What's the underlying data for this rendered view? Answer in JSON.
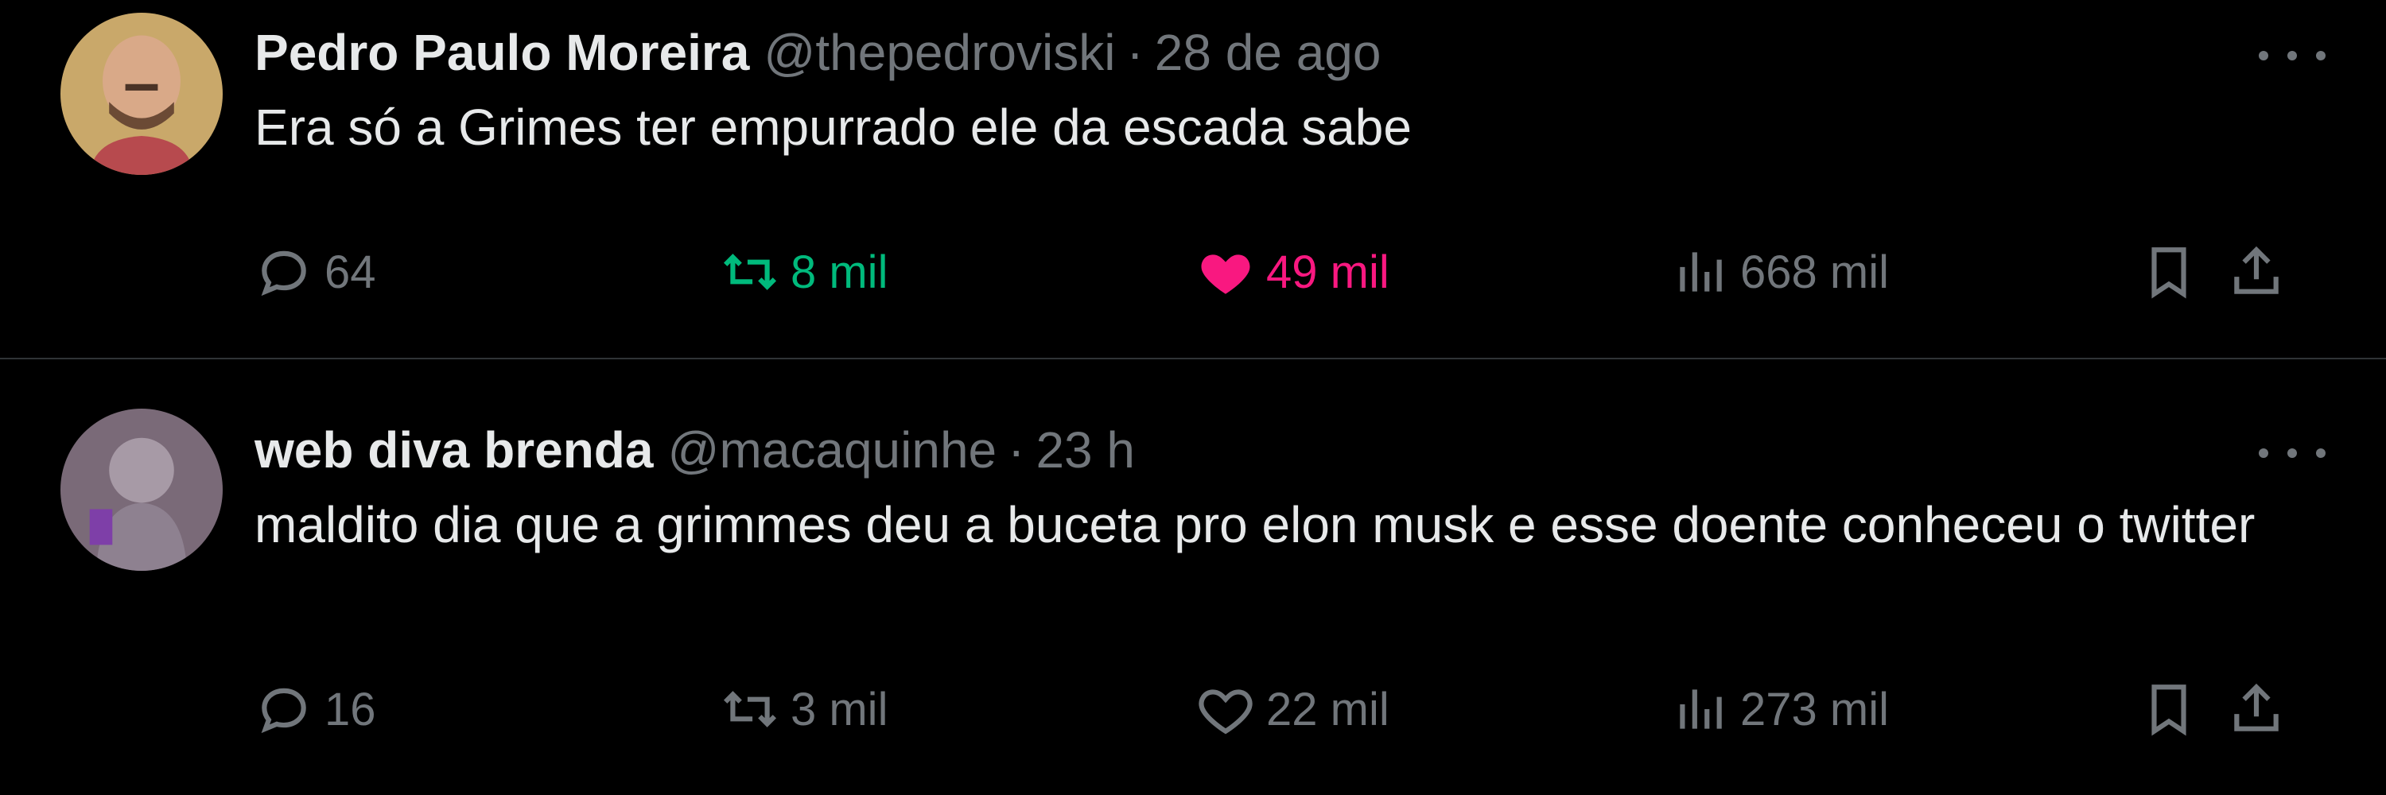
{
  "tweets": [
    {
      "author_name": "Pedro Paulo Moreira",
      "handle": "@thepedroviski",
      "separator": "·",
      "time": "28 de ago",
      "text": "Era só a Grimes ter empurrado ele da escada sabe",
      "replies": "64",
      "retweets": "8 mil",
      "likes": "49 mil",
      "views": "668 mil",
      "retweeted": true,
      "liked": true
    },
    {
      "author_name": "web diva brenda",
      "handle": "@macaquinhe",
      "separator": "·",
      "time": "23 h",
      "text": "maldito dia que a grimmes deu a buceta pro elon musk e esse doente conheceu o twitter",
      "replies": "16",
      "retweets": "3 mil",
      "likes": "22 mil",
      "views": "273 mil",
      "retweeted": false,
      "liked": false
    }
  ],
  "colors": {
    "background": "#000000",
    "text_primary": "#e7e9ea",
    "text_secondary": "#71767b",
    "retweet_active": "#00ba7c",
    "like_active": "#f91880",
    "divider": "#2f3336"
  },
  "icons": [
    "reply-icon",
    "retweet-icon",
    "like-icon",
    "views-icon",
    "bookmark-icon",
    "share-icon",
    "more-icon"
  ]
}
